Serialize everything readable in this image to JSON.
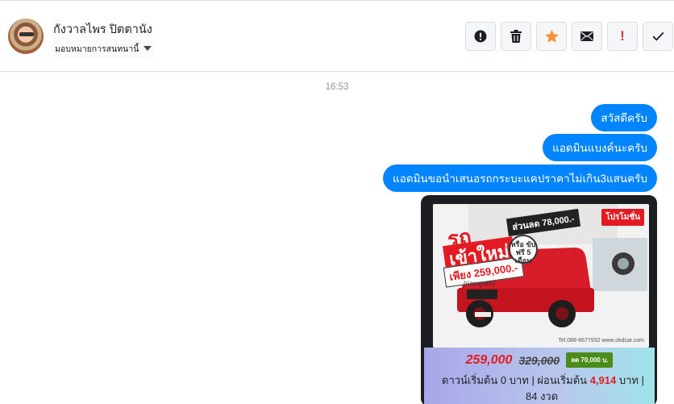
{
  "header": {
    "contact_name": "กังวาลไพร ปิตตานัง",
    "assign_label": "มอบหมายการสนทนานี้",
    "actions": [
      {
        "name": "spam-button",
        "icon": "alert-circle-icon"
      },
      {
        "name": "delete-button",
        "icon": "trash-icon"
      },
      {
        "name": "star-button",
        "icon": "star-icon",
        "color": "#f7923a"
      },
      {
        "name": "mark-unread-button",
        "icon": "envelope-icon"
      },
      {
        "name": "follow-up-button",
        "icon": "exclamation-icon",
        "text": "!",
        "color": "#d93025"
      },
      {
        "name": "mark-done-button",
        "icon": "check-icon"
      }
    ]
  },
  "conversation": {
    "timestamp": "16:53",
    "messages": [
      {
        "text": "สวัสดีครับ"
      },
      {
        "text": "แอดมินแบงค์นะครับ"
      },
      {
        "text": "แอดมินขอนำเสนอรถกระบะแคปราคาไม่เกิน3แสนครับ"
      }
    ],
    "ad_image": {
      "badge": "โปรโมชั่น",
      "headline_1": "รถ",
      "headline_2": "เข้าใหม่",
      "discount": "ส่วนลด 78,000.-",
      "headline_price": "เพียง 259,000.-",
      "fine_print": "(ผ่อนสูงสุด)",
      "stamp": "หรือ ขับฟรี 5 เดือน",
      "contact": "Tel.088-6677932 www.okdcar.com",
      "price_new": "259,000",
      "price_old": "329,000",
      "price_save": "ลด 70,000 บ.",
      "terms_prefix": "ดาวน์เริ่มต้น 0 บาท | ผ่อนเริ่มต้น ",
      "installment": "4,914",
      "terms_suffix": " บาท |",
      "terms_line2": "84 งวด"
    }
  },
  "colors": {
    "accent": "#0084ff",
    "star": "#f7923a",
    "alert": "#d93025"
  }
}
